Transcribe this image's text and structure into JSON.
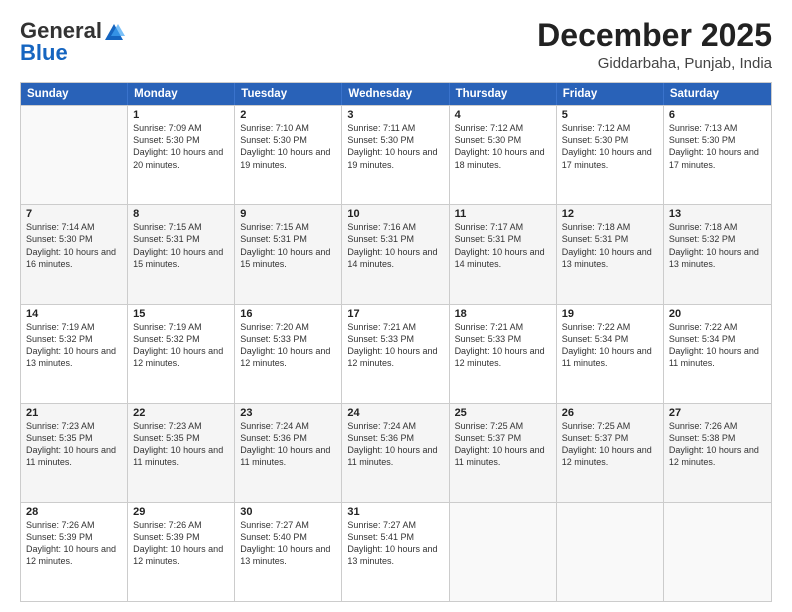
{
  "logo": {
    "general": "General",
    "blue": "Blue"
  },
  "title": "December 2025",
  "location": "Giddarbaha, Punjab, India",
  "days_of_week": [
    "Sunday",
    "Monday",
    "Tuesday",
    "Wednesday",
    "Thursday",
    "Friday",
    "Saturday"
  ],
  "rows": [
    [
      {
        "day": "",
        "sunrise": "",
        "sunset": "",
        "daylight": "",
        "empty": true
      },
      {
        "day": "1",
        "sunrise": "Sunrise: 7:09 AM",
        "sunset": "Sunset: 5:30 PM",
        "daylight": "Daylight: 10 hours and 20 minutes.",
        "empty": false
      },
      {
        "day": "2",
        "sunrise": "Sunrise: 7:10 AM",
        "sunset": "Sunset: 5:30 PM",
        "daylight": "Daylight: 10 hours and 19 minutes.",
        "empty": false
      },
      {
        "day": "3",
        "sunrise": "Sunrise: 7:11 AM",
        "sunset": "Sunset: 5:30 PM",
        "daylight": "Daylight: 10 hours and 19 minutes.",
        "empty": false
      },
      {
        "day": "4",
        "sunrise": "Sunrise: 7:12 AM",
        "sunset": "Sunset: 5:30 PM",
        "daylight": "Daylight: 10 hours and 18 minutes.",
        "empty": false
      },
      {
        "day": "5",
        "sunrise": "Sunrise: 7:12 AM",
        "sunset": "Sunset: 5:30 PM",
        "daylight": "Daylight: 10 hours and 17 minutes.",
        "empty": false
      },
      {
        "day": "6",
        "sunrise": "Sunrise: 7:13 AM",
        "sunset": "Sunset: 5:30 PM",
        "daylight": "Daylight: 10 hours and 17 minutes.",
        "empty": false
      }
    ],
    [
      {
        "day": "7",
        "sunrise": "Sunrise: 7:14 AM",
        "sunset": "Sunset: 5:30 PM",
        "daylight": "Daylight: 10 hours and 16 minutes.",
        "empty": false
      },
      {
        "day": "8",
        "sunrise": "Sunrise: 7:15 AM",
        "sunset": "Sunset: 5:31 PM",
        "daylight": "Daylight: 10 hours and 15 minutes.",
        "empty": false
      },
      {
        "day": "9",
        "sunrise": "Sunrise: 7:15 AM",
        "sunset": "Sunset: 5:31 PM",
        "daylight": "Daylight: 10 hours and 15 minutes.",
        "empty": false
      },
      {
        "day": "10",
        "sunrise": "Sunrise: 7:16 AM",
        "sunset": "Sunset: 5:31 PM",
        "daylight": "Daylight: 10 hours and 14 minutes.",
        "empty": false
      },
      {
        "day": "11",
        "sunrise": "Sunrise: 7:17 AM",
        "sunset": "Sunset: 5:31 PM",
        "daylight": "Daylight: 10 hours and 14 minutes.",
        "empty": false
      },
      {
        "day": "12",
        "sunrise": "Sunrise: 7:18 AM",
        "sunset": "Sunset: 5:31 PM",
        "daylight": "Daylight: 10 hours and 13 minutes.",
        "empty": false
      },
      {
        "day": "13",
        "sunrise": "Sunrise: 7:18 AM",
        "sunset": "Sunset: 5:32 PM",
        "daylight": "Daylight: 10 hours and 13 minutes.",
        "empty": false
      }
    ],
    [
      {
        "day": "14",
        "sunrise": "Sunrise: 7:19 AM",
        "sunset": "Sunset: 5:32 PM",
        "daylight": "Daylight: 10 hours and 13 minutes.",
        "empty": false
      },
      {
        "day": "15",
        "sunrise": "Sunrise: 7:19 AM",
        "sunset": "Sunset: 5:32 PM",
        "daylight": "Daylight: 10 hours and 12 minutes.",
        "empty": false
      },
      {
        "day": "16",
        "sunrise": "Sunrise: 7:20 AM",
        "sunset": "Sunset: 5:33 PM",
        "daylight": "Daylight: 10 hours and 12 minutes.",
        "empty": false
      },
      {
        "day": "17",
        "sunrise": "Sunrise: 7:21 AM",
        "sunset": "Sunset: 5:33 PM",
        "daylight": "Daylight: 10 hours and 12 minutes.",
        "empty": false
      },
      {
        "day": "18",
        "sunrise": "Sunrise: 7:21 AM",
        "sunset": "Sunset: 5:33 PM",
        "daylight": "Daylight: 10 hours and 12 minutes.",
        "empty": false
      },
      {
        "day": "19",
        "sunrise": "Sunrise: 7:22 AM",
        "sunset": "Sunset: 5:34 PM",
        "daylight": "Daylight: 10 hours and 11 minutes.",
        "empty": false
      },
      {
        "day": "20",
        "sunrise": "Sunrise: 7:22 AM",
        "sunset": "Sunset: 5:34 PM",
        "daylight": "Daylight: 10 hours and 11 minutes.",
        "empty": false
      }
    ],
    [
      {
        "day": "21",
        "sunrise": "Sunrise: 7:23 AM",
        "sunset": "Sunset: 5:35 PM",
        "daylight": "Daylight: 10 hours and 11 minutes.",
        "empty": false
      },
      {
        "day": "22",
        "sunrise": "Sunrise: 7:23 AM",
        "sunset": "Sunset: 5:35 PM",
        "daylight": "Daylight: 10 hours and 11 minutes.",
        "empty": false
      },
      {
        "day": "23",
        "sunrise": "Sunrise: 7:24 AM",
        "sunset": "Sunset: 5:36 PM",
        "daylight": "Daylight: 10 hours and 11 minutes.",
        "empty": false
      },
      {
        "day": "24",
        "sunrise": "Sunrise: 7:24 AM",
        "sunset": "Sunset: 5:36 PM",
        "daylight": "Daylight: 10 hours and 11 minutes.",
        "empty": false
      },
      {
        "day": "25",
        "sunrise": "Sunrise: 7:25 AM",
        "sunset": "Sunset: 5:37 PM",
        "daylight": "Daylight: 10 hours and 11 minutes.",
        "empty": false
      },
      {
        "day": "26",
        "sunrise": "Sunrise: 7:25 AM",
        "sunset": "Sunset: 5:37 PM",
        "daylight": "Daylight: 10 hours and 12 minutes.",
        "empty": false
      },
      {
        "day": "27",
        "sunrise": "Sunrise: 7:26 AM",
        "sunset": "Sunset: 5:38 PM",
        "daylight": "Daylight: 10 hours and 12 minutes.",
        "empty": false
      }
    ],
    [
      {
        "day": "28",
        "sunrise": "Sunrise: 7:26 AM",
        "sunset": "Sunset: 5:39 PM",
        "daylight": "Daylight: 10 hours and 12 minutes.",
        "empty": false
      },
      {
        "day": "29",
        "sunrise": "Sunrise: 7:26 AM",
        "sunset": "Sunset: 5:39 PM",
        "daylight": "Daylight: 10 hours and 12 minutes.",
        "empty": false
      },
      {
        "day": "30",
        "sunrise": "Sunrise: 7:27 AM",
        "sunset": "Sunset: 5:40 PM",
        "daylight": "Daylight: 10 hours and 13 minutes.",
        "empty": false
      },
      {
        "day": "31",
        "sunrise": "Sunrise: 7:27 AM",
        "sunset": "Sunset: 5:41 PM",
        "daylight": "Daylight: 10 hours and 13 minutes.",
        "empty": false
      },
      {
        "day": "",
        "sunrise": "",
        "sunset": "",
        "daylight": "",
        "empty": true
      },
      {
        "day": "",
        "sunrise": "",
        "sunset": "",
        "daylight": "",
        "empty": true
      },
      {
        "day": "",
        "sunrise": "",
        "sunset": "",
        "daylight": "",
        "empty": true
      }
    ]
  ]
}
